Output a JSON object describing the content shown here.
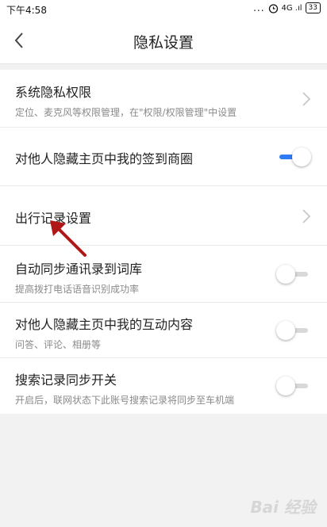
{
  "status_bar": {
    "time": "下午4:58",
    "dots": "...",
    "signal": "4G .ıl",
    "battery": "33"
  },
  "nav": {
    "title": "隐私设置"
  },
  "rows": [
    {
      "title": "系统隐私权限",
      "subtitle": "定位、麦克风等权限管理，在\"权限/权限管理\"中设置",
      "control": "chevron"
    },
    {
      "title": "对他人隐藏主页中我的签到商圈",
      "control": "switch",
      "on": true
    },
    {
      "title": "出行记录设置",
      "control": "chevron"
    },
    {
      "title": "自动同步通讯录到词库",
      "subtitle": "提高拨打电话语音识别成功率",
      "control": "switch",
      "on": false
    },
    {
      "title": "对他人隐藏主页中我的互动内容",
      "subtitle": "问答、评论、相册等",
      "control": "switch",
      "on": false
    },
    {
      "title": "搜索记录同步开关",
      "subtitle": "开启后，联网状态下此账号搜索记录将同步至车机端",
      "control": "switch",
      "on": false
    }
  ],
  "watermark": "Bai 经验",
  "colors": {
    "accent": "#2f7cf6",
    "annotation_arrow": "#b01818"
  }
}
